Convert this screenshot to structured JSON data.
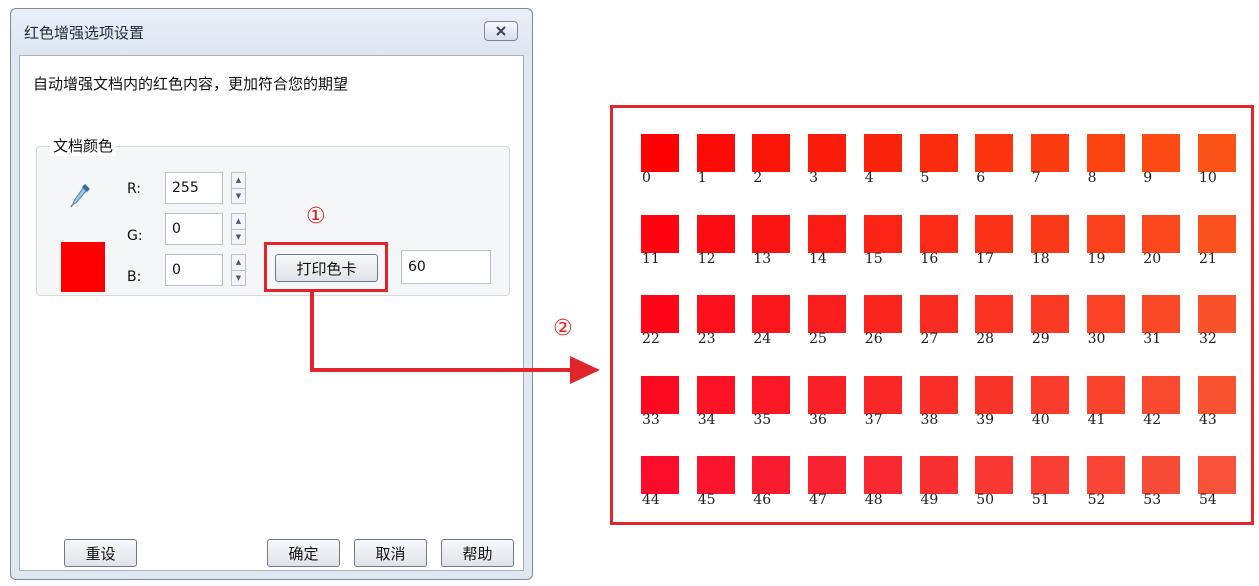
{
  "dialog": {
    "title": "红色增强选项设置",
    "subtitle": "自动增强文档内的红色内容，更加符合您的期望",
    "group_label": "文档颜色",
    "r_label": "R:",
    "g_label": "G:",
    "b_label": "B:",
    "r_value": "255",
    "g_value": "0",
    "b_value": "0",
    "swatch_color": "#ff0000",
    "print_button": "打印色卡",
    "count_value": "60",
    "reset_button": "重设",
    "ok_button": "确定",
    "cancel_button": "取消",
    "help_button": "帮助"
  },
  "annotations": {
    "step1": "①",
    "step2": "②"
  },
  "accent_color": "#e0262b",
  "color_card": {
    "chips": [
      {
        "n": "0",
        "c": "#ff0000"
      },
      {
        "n": "1",
        "c": "#fc0c06"
      },
      {
        "n": "2",
        "c": "#fb1508"
      },
      {
        "n": "3",
        "c": "#f91c0a"
      },
      {
        "n": "4",
        "c": "#fa230b"
      },
      {
        "n": "5",
        "c": "#fb2c0d"
      },
      {
        "n": "6",
        "c": "#fc340f"
      },
      {
        "n": "7",
        "c": "#fb3b10"
      },
      {
        "n": "8",
        "c": "#fb4312"
      },
      {
        "n": "9",
        "c": "#fb4a14"
      },
      {
        "n": "10",
        "c": "#fb5316"
      },
      {
        "n": "11",
        "c": "#ff0410"
      },
      {
        "n": "12",
        "c": "#fc0d13"
      },
      {
        "n": "13",
        "c": "#fb1414"
      },
      {
        "n": "14",
        "c": "#fa1c15"
      },
      {
        "n": "15",
        "c": "#fb2416"
      },
      {
        "n": "16",
        "c": "#fa2b17"
      },
      {
        "n": "17",
        "c": "#fa3218"
      },
      {
        "n": "18",
        "c": "#fa3919"
      },
      {
        "n": "19",
        "c": "#fa411b"
      },
      {
        "n": "20",
        "c": "#fa481c"
      },
      {
        "n": "21",
        "c": "#fa511e"
      },
      {
        "n": "22",
        "c": "#fd0718"
      },
      {
        "n": "23",
        "c": "#fc101c"
      },
      {
        "n": "24",
        "c": "#fb171d"
      },
      {
        "n": "25",
        "c": "#fa1e1e"
      },
      {
        "n": "26",
        "c": "#fa251f"
      },
      {
        "n": "27",
        "c": "#fa2c21"
      },
      {
        "n": "28",
        "c": "#fa3322"
      },
      {
        "n": "29",
        "c": "#f93a24"
      },
      {
        "n": "30",
        "c": "#f94226"
      },
      {
        "n": "31",
        "c": "#f94927"
      },
      {
        "n": "32",
        "c": "#f95129"
      },
      {
        "n": "33",
        "c": "#fc0a22"
      },
      {
        "n": "34",
        "c": "#fb1225"
      },
      {
        "n": "35",
        "c": "#fb1926"
      },
      {
        "n": "36",
        "c": "#fa2027"
      },
      {
        "n": "37",
        "c": "#fa2728"
      },
      {
        "n": "38",
        "c": "#fa2e29"
      },
      {
        "n": "39",
        "c": "#f9352a"
      },
      {
        "n": "40",
        "c": "#f93c2c"
      },
      {
        "n": "41",
        "c": "#f9432d"
      },
      {
        "n": "42",
        "c": "#f94a2f"
      },
      {
        "n": "43",
        "c": "#f95231"
      },
      {
        "n": "44",
        "c": "#fa0c2a"
      },
      {
        "n": "45",
        "c": "#fa142e"
      },
      {
        "n": "46",
        "c": "#fa1b2f"
      },
      {
        "n": "47",
        "c": "#f92230"
      },
      {
        "n": "48",
        "c": "#f92931"
      },
      {
        "n": "49",
        "c": "#f93032"
      },
      {
        "n": "50",
        "c": "#f93733"
      },
      {
        "n": "51",
        "c": "#f93e35"
      },
      {
        "n": "52",
        "c": "#f94536"
      },
      {
        "n": "53",
        "c": "#f84c38"
      },
      {
        "n": "54",
        "c": "#f8533a"
      }
    ]
  }
}
